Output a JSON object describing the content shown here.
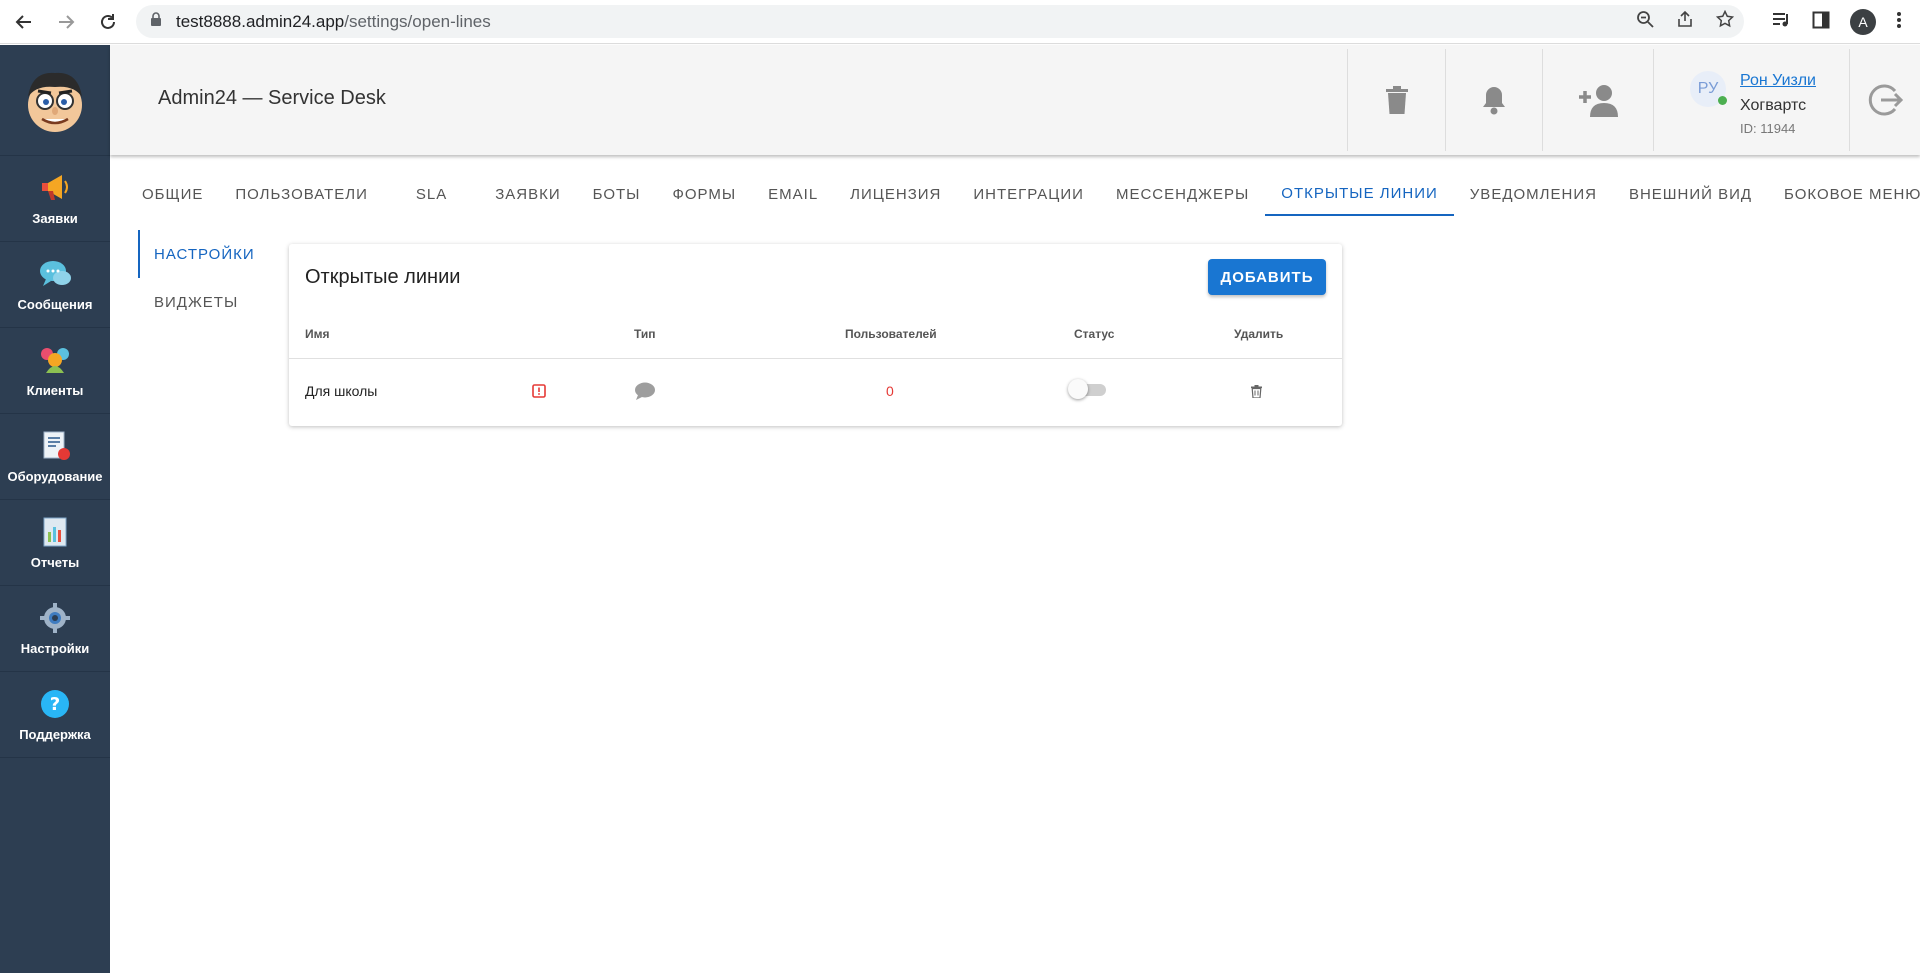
{
  "browser": {
    "url_host": "test8888.admin24.app",
    "url_path": "/settings/open-lines",
    "profile_initial": "A"
  },
  "sidebar": {
    "items": [
      {
        "label": "Заявки",
        "icon": "megaphone-icon"
      },
      {
        "label": "Сообщения",
        "icon": "chat-bubbles-icon"
      },
      {
        "label": "Клиенты",
        "icon": "people-icon"
      },
      {
        "label": "Оборудование",
        "icon": "equipment-icon"
      },
      {
        "label": "Отчеты",
        "icon": "report-icon"
      },
      {
        "label": "Настройки",
        "icon": "gear-icon"
      },
      {
        "label": "Поддержка",
        "icon": "help-icon"
      }
    ]
  },
  "header": {
    "title": "Admin24 — Service Desk",
    "user": {
      "initials": "РУ",
      "name": "Рон Уизли",
      "org": "Хогвартс",
      "id": "ID: 11944"
    }
  },
  "tabs": [
    {
      "label": "Общие",
      "active": false
    },
    {
      "label": "Пользователи",
      "active": false
    },
    {
      "label": "SLA",
      "active": false
    },
    {
      "label": "Заявки",
      "active": false
    },
    {
      "label": "Боты",
      "active": false
    },
    {
      "label": "Формы",
      "active": false
    },
    {
      "label": "Email",
      "active": false
    },
    {
      "label": "Лицензия",
      "active": false
    },
    {
      "label": "Интеграции",
      "active": false
    },
    {
      "label": "Мессенджеры",
      "active": false
    },
    {
      "label": "Открытые линии",
      "active": true
    },
    {
      "label": "Уведомления",
      "active": false
    },
    {
      "label": "Внешний вид",
      "active": false
    },
    {
      "label": "Боковое меню",
      "active": false
    }
  ],
  "subtabs": [
    {
      "label": "НАСТРОЙКИ",
      "active": true
    },
    {
      "label": "ВИДЖЕТЫ",
      "active": false
    }
  ],
  "card": {
    "title": "Открытые линии",
    "add_label": "ДОБАВИТЬ",
    "columns": {
      "name": "Имя",
      "type": "Тип",
      "users": "Пользователей",
      "status": "Статус",
      "delete": "Удалить"
    },
    "rows": [
      {
        "name": "Для школы",
        "users": "0",
        "status_on": false
      }
    ]
  },
  "colors": {
    "accent": "#1976d2",
    "sidebar": "#2d3e52",
    "warning": "#e53935"
  }
}
